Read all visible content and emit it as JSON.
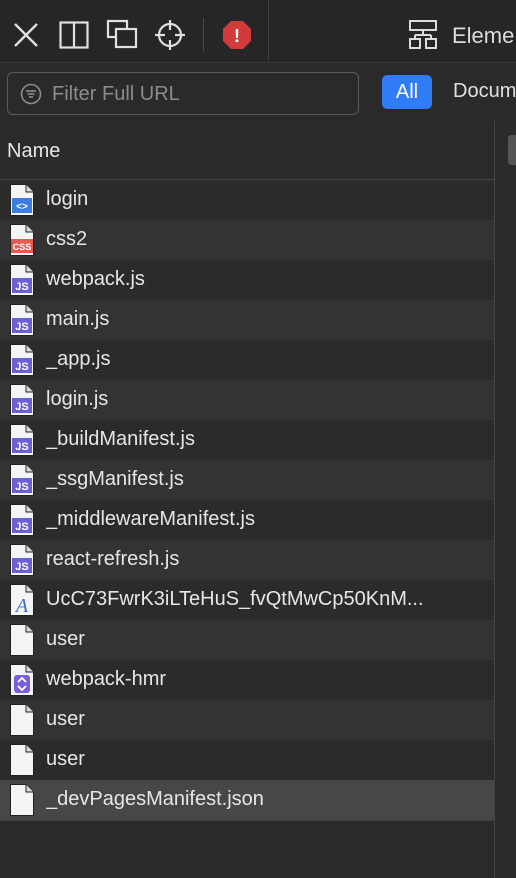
{
  "toolbar": {
    "icons": [
      "close-icon",
      "split-view-icon",
      "window-stack-icon",
      "crosshair-icon",
      "error-badge-icon"
    ],
    "error_badge": "!",
    "tab_label": "Eleme"
  },
  "filter": {
    "placeholder": "Filter Full URL",
    "value": "",
    "types": [
      "All",
      "Docum"
    ],
    "active_type": "All",
    "colors": {
      "active": "#2f7cf6"
    }
  },
  "table": {
    "column_header": "Name",
    "rows": [
      {
        "label": "login",
        "icon": "html-icon"
      },
      {
        "label": "css2",
        "icon": "css-icon"
      },
      {
        "label": "webpack.js",
        "icon": "js-icon"
      },
      {
        "label": "main.js",
        "icon": "js-icon"
      },
      {
        "label": "_app.js",
        "icon": "js-icon"
      },
      {
        "label": "login.js",
        "icon": "js-icon"
      },
      {
        "label": "_buildManifest.js",
        "icon": "js-icon"
      },
      {
        "label": "_ssgManifest.js",
        "icon": "js-icon"
      },
      {
        "label": "_middlewareManifest.js",
        "icon": "js-icon"
      },
      {
        "label": "react-refresh.js",
        "icon": "js-icon"
      },
      {
        "label": "UcC73FwrK3iLTeHuS_fvQtMwCp50KnM...",
        "icon": "font-icon"
      },
      {
        "label": "user",
        "icon": "blank-file-icon"
      },
      {
        "label": "webpack-hmr",
        "icon": "event-stream-icon"
      },
      {
        "label": "user",
        "icon": "blank-file-icon"
      },
      {
        "label": "user",
        "icon": "blank-file-icon"
      },
      {
        "label": "_devPagesManifest.json",
        "icon": "blank-file-icon"
      }
    ],
    "selected_index": 15
  },
  "file_icon_glyphs": {
    "html-icon": "<>",
    "css-icon": "CSS",
    "js-icon": "JS",
    "font-icon": "A"
  }
}
